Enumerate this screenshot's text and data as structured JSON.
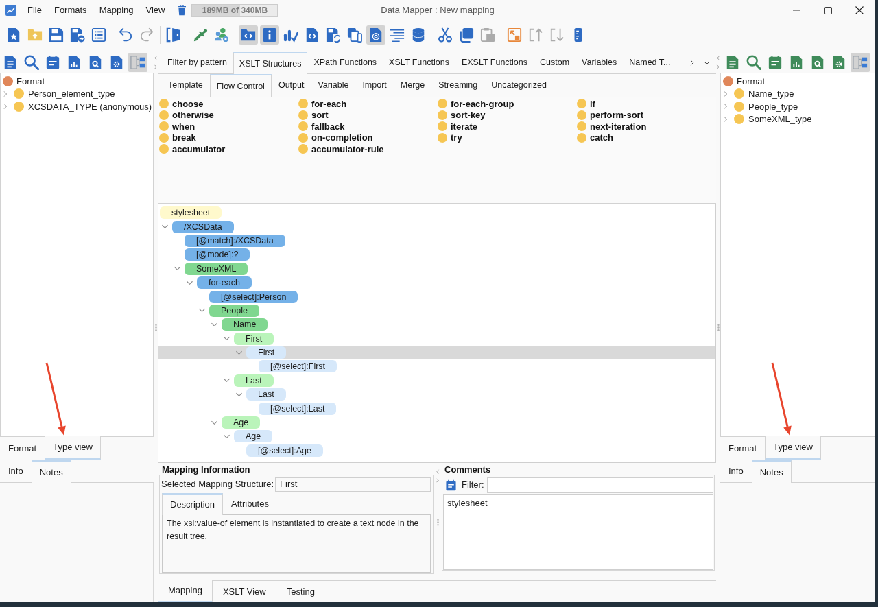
{
  "window": {
    "title": "Data Mapper : New mapping"
  },
  "menu": [
    "File",
    "Formats",
    "Mapping",
    "View"
  ],
  "memory": {
    "reading": "189MB of 340MB",
    "level": 0.56
  },
  "toolbar": [
    {
      "separator": false,
      "buttons": [
        {
          "active": false,
          "disabled": false
        },
        {
          "active": false,
          "disabled": false
        },
        {
          "active": false,
          "disabled": false
        },
        {
          "active": false,
          "disabled": false
        },
        {
          "active": false,
          "disabled": false
        }
      ]
    },
    {
      "separator": true,
      "buttons": [
        {
          "active": false,
          "disabled": false
        },
        {
          "active": false,
          "disabled": true
        }
      ]
    },
    {
      "separator": true,
      "buttons": [
        {
          "active": false,
          "disabled": false
        }
      ]
    },
    {
      "separator": false,
      "buttons": [
        {
          "active": false,
          "disabled": false
        },
        {
          "active": false,
          "disabled": false
        }
      ]
    },
    {
      "separator": false,
      "buttons": [
        {
          "active": true,
          "disabled": false
        },
        {
          "active": true,
          "disabled": false
        },
        {
          "active": false,
          "disabled": false
        },
        {
          "active": false,
          "disabled": false
        },
        {
          "active": false,
          "disabled": false
        },
        {
          "active": false,
          "disabled": false
        },
        {
          "active": true,
          "disabled": false
        },
        {
          "active": false,
          "disabled": false
        },
        {
          "active": false,
          "disabled": false
        }
      ]
    },
    {
      "separator": false,
      "buttons": [
        {
          "active": false,
          "disabled": false
        },
        {
          "active": false,
          "disabled": false
        },
        {
          "active": false,
          "disabled": true
        }
      ]
    },
    {
      "separator": false,
      "buttons": [
        {
          "active": false,
          "disabled": false
        },
        {
          "active": false,
          "disabled": true
        },
        {
          "active": false,
          "disabled": true
        },
        {
          "active": false,
          "disabled": false
        }
      ]
    }
  ],
  "left_panel": {
    "tools": [
      {
        "active": false
      },
      {
        "active": false
      },
      {
        "active": false
      },
      {
        "active": false
      },
      {
        "active": false
      },
      {
        "active": false
      },
      {
        "active": true
      }
    ],
    "tree": [
      {
        "label": "Format",
        "color": "#e0875a",
        "children": [
          {
            "label": "Person_element_type",
            "color": "#f6c653",
            "expanded": false
          },
          {
            "label": "XCSDATA_TYPE (anonymous)",
            "color": "#f6c653",
            "expanded": false
          }
        ]
      }
    ],
    "view_tabs": [
      {
        "label": "Format",
        "selected": false
      },
      {
        "label": "Type view",
        "selected": true
      }
    ],
    "info_tabs": [
      {
        "label": "Info",
        "selected": false
      },
      {
        "label": "Notes",
        "selected": true
      }
    ]
  },
  "structure_tabs": [
    {
      "label": "Filter by pattern",
      "selected": false
    },
    {
      "label": "XSLT Structures",
      "selected": true
    },
    {
      "label": "XPath Functions",
      "selected": false
    },
    {
      "label": "XSLT Functions",
      "selected": false
    },
    {
      "label": "EXSLT Functions",
      "selected": false
    },
    {
      "label": "Custom",
      "selected": false
    },
    {
      "label": "Variables",
      "selected": false
    },
    {
      "label": "Named T...",
      "selected": false
    }
  ],
  "category_tabs": [
    {
      "label": "Template",
      "selected": false
    },
    {
      "label": "Flow Control",
      "selected": true
    },
    {
      "label": "Output",
      "selected": false
    },
    {
      "label": "Variable",
      "selected": false
    },
    {
      "label": "Import",
      "selected": false
    },
    {
      "label": "Merge",
      "selected": false
    },
    {
      "label": "Streaming",
      "selected": false
    },
    {
      "label": "Uncategorized",
      "selected": false
    }
  ],
  "structures": [
    [
      "choose",
      "otherwise",
      "when",
      "break",
      "accumulator"
    ],
    [
      "for-each",
      "sort",
      "fallback",
      "on-completion",
      "accumulator-rule"
    ],
    [
      "for-each-group",
      "sort-key",
      "iterate",
      "try"
    ],
    [
      "if",
      "perform-sort",
      "next-iteration",
      "catch"
    ]
  ],
  "mapping_tree": [
    {
      "label": "stylesheet",
      "color": "#fff9cc",
      "selected": false,
      "children": [
        {
          "label": "/XCSData",
          "color": "#74b1e8",
          "expanded": true,
          "selected": false,
          "children": [
            {
              "label": "[@match]:/XCSData",
              "color": "#74b1e8",
              "selected": false
            },
            {
              "label": "[@mode]:?",
              "color": "#74b1e8",
              "selected": false
            },
            {
              "label": "SomeXML",
              "color": "#80d790",
              "expanded": true,
              "selected": false,
              "children": [
                {
                  "label": "for-each",
                  "color": "#74b1e8",
                  "expanded": true,
                  "selected": false,
                  "children": [
                    {
                      "label": "[@select]:Person",
                      "color": "#74b1e8",
                      "selected": false
                    },
                    {
                      "label": "People",
                      "color": "#80d790",
                      "expanded": true,
                      "selected": false,
                      "children": [
                        {
                          "label": "Name",
                          "color": "#80d790",
                          "expanded": true,
                          "selected": false,
                          "children": [
                            {
                              "label": "First",
                              "color": "#baf4ba",
                              "expanded": true,
                              "selected": false,
                              "children": [
                                {
                                  "label": "First",
                                  "color": "#d6e8fa",
                                  "expanded": true,
                                  "selected": true,
                                  "children": [
                                    {
                                      "label": "[@select]:First",
                                      "color": "#d6e8fa",
                                      "selected": false
                                    }
                                  ]
                                }
                              ]
                            },
                            {
                              "label": "Last",
                              "color": "#baf4ba",
                              "expanded": true,
                              "selected": false,
                              "children": [
                                {
                                  "label": "Last",
                                  "color": "#d6e8fa",
                                  "expanded": true,
                                  "selected": false,
                                  "children": [
                                    {
                                      "label": "[@select]:Last",
                                      "color": "#d6e8fa",
                                      "selected": false
                                    }
                                  ]
                                }
                              ]
                            }
                          ]
                        },
                        {
                          "label": "Age",
                          "color": "#baf4ba",
                          "expanded": true,
                          "selected": false,
                          "children": [
                            {
                              "label": "Age",
                              "color": "#d6e8fa",
                              "expanded": true,
                              "selected": false,
                              "children": [
                                {
                                  "label": "[@select]:Age",
                                  "color": "#d6e8fa",
                                  "selected": false
                                }
                              ]
                            }
                          ]
                        }
                      ]
                    }
                  ]
                }
              ]
            }
          ]
        }
      ]
    }
  ],
  "mapping_information": {
    "title": "Mapping Information",
    "field_label": "Selected Mapping Structure:",
    "field_value": "First",
    "tabs": [
      {
        "label": "Description",
        "selected": true
      },
      {
        "label": "Attributes",
        "selected": false
      }
    ],
    "description": "The xsl:value-of element is instantiated to create a text node in the result tree."
  },
  "comments": {
    "title": "Comments",
    "filter_label": "Filter:",
    "items": [
      "stylesheet"
    ]
  },
  "view_tabs": [
    {
      "label": "Mapping",
      "selected": true
    },
    {
      "label": "XSLT View",
      "selected": false
    },
    {
      "label": "Testing",
      "selected": false
    }
  ],
  "right_panel": {
    "tools": [
      {
        "active": false
      },
      {
        "active": false
      },
      {
        "active": false
      },
      {
        "active": false
      },
      {
        "active": false
      },
      {
        "active": false
      },
      {
        "active": true
      }
    ],
    "tree": [
      {
        "label": "Format",
        "color": "#e0875a",
        "children": [
          {
            "label": "Name_type",
            "color": "#f6c653",
            "expanded": false
          },
          {
            "label": "People_type",
            "color": "#f6c653",
            "expanded": false
          },
          {
            "label": "SomeXML_type",
            "color": "#f6c653",
            "expanded": false
          }
        ]
      }
    ],
    "view_tabs": [
      {
        "label": "Format",
        "selected": false
      },
      {
        "label": "Type view",
        "selected": true
      }
    ],
    "info_tabs": [
      {
        "label": "Info",
        "selected": false
      },
      {
        "label": "Notes",
        "selected": true
      }
    ]
  }
}
